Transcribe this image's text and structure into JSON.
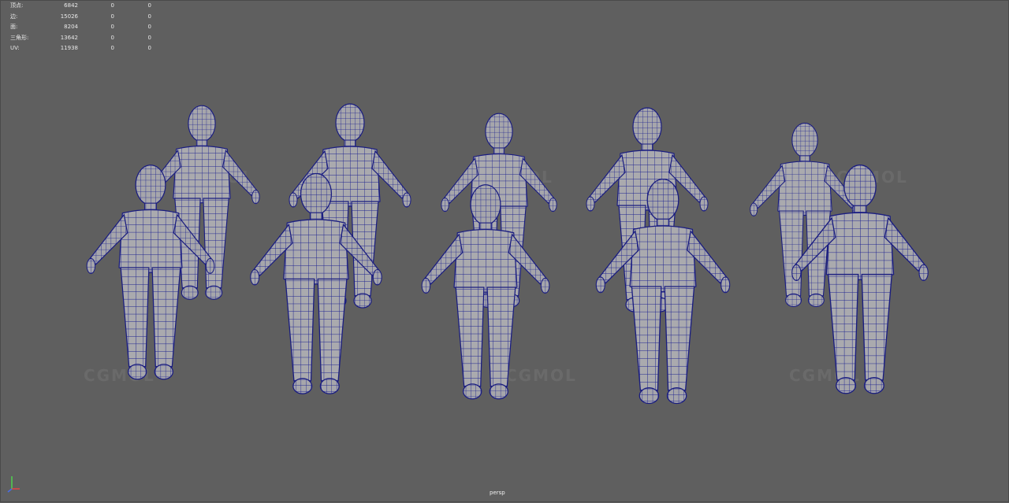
{
  "hud": {
    "rows": [
      {
        "label": "顶点:",
        "v1": "6842",
        "v2": "0",
        "v3": "0"
      },
      {
        "label": "边:",
        "v1": "15026",
        "v2": "0",
        "v3": "0"
      },
      {
        "label": "面:",
        "v1": "8204",
        "v2": "0",
        "v3": "0"
      },
      {
        "label": "三角形:",
        "v1": "13642",
        "v2": "0",
        "v3": "0"
      },
      {
        "label": "UV:",
        "v1": "11938",
        "v2": "0",
        "v3": "0"
      }
    ]
  },
  "camera_label": "persp",
  "watermark_text": "CGMOL",
  "colors": {
    "viewport_bg": "#5f5f5f",
    "mesh_fill": "#a9a9ad",
    "wire": "#1c1f8a"
  }
}
